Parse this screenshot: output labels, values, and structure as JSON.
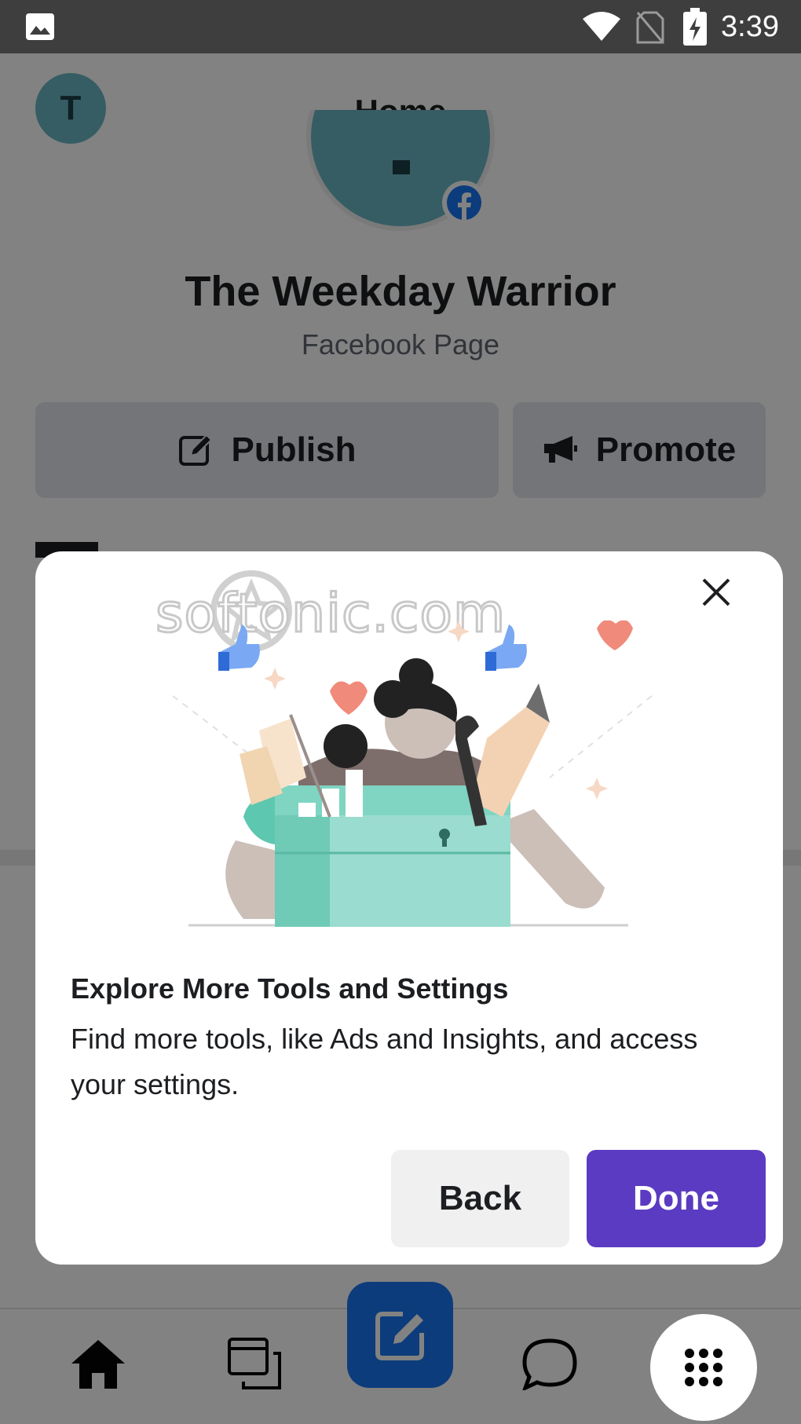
{
  "status_bar": {
    "time": "3:39",
    "icons": [
      "gallery-icon",
      "wifi-icon",
      "no-sim-icon",
      "battery-charging-icon"
    ]
  },
  "header": {
    "avatar_letter": "T",
    "title": "Home"
  },
  "page": {
    "name": "The Weekday Warrior",
    "type": "Facebook Page"
  },
  "actions": {
    "publish_label": "Publish",
    "promote_label": "Promote"
  },
  "dialog": {
    "watermark": "softonic.com",
    "title": "Explore More Tools and Settings",
    "body": "Find more tools, like Ads and Insights, and access your settings.",
    "back_label": "Back",
    "done_label": "Done"
  },
  "bottom_nav": {
    "items": [
      "home-icon",
      "posts-icon",
      "compose-icon",
      "inbox-icon",
      "menu-grid-icon"
    ]
  },
  "colors": {
    "status_bar": "#3e3e3e",
    "facebook_blue": "#1877f2",
    "done_button": "#5b3bc1",
    "avatar": "#6ab7c4"
  }
}
